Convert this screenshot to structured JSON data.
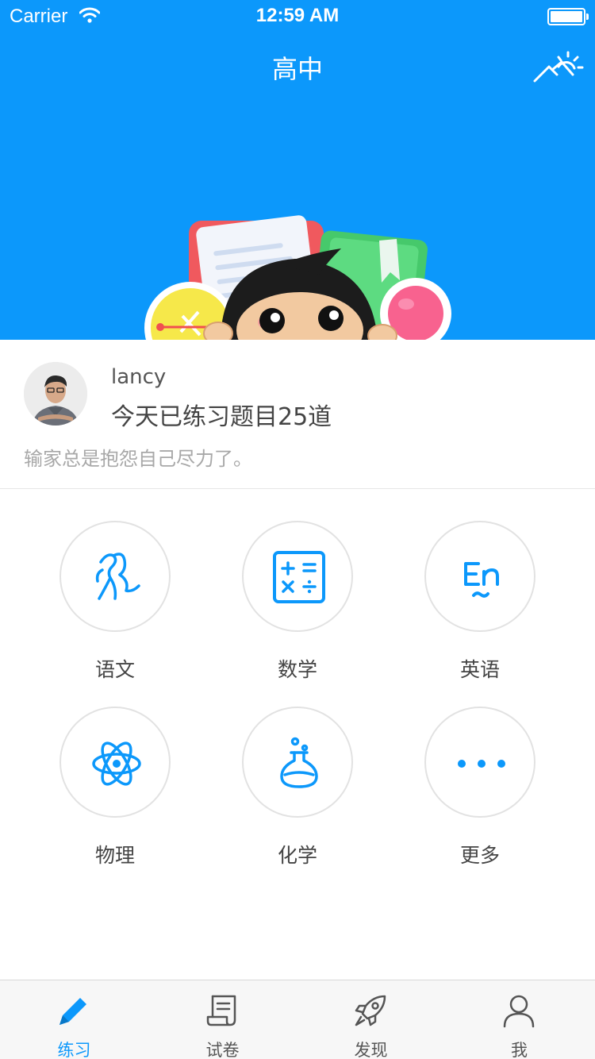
{
  "status_bar": {
    "carrier": "Carrier",
    "time": "12:59 AM"
  },
  "nav": {
    "title": "高中",
    "weather_icon": "weather-sun-mountain-icon"
  },
  "profile": {
    "username": "lancy",
    "today_text": "今天已练习题目25道",
    "motto": "输家总是抱怨自己尽力了。"
  },
  "subjects": [
    {
      "label": "语文",
      "icon": "chinese-brush-icon"
    },
    {
      "label": "数学",
      "icon": "calculator-icon"
    },
    {
      "label": "英语",
      "icon": "english-en-icon"
    },
    {
      "label": "物理",
      "icon": "atom-icon"
    },
    {
      "label": "化学",
      "icon": "flask-icon"
    },
    {
      "label": "更多",
      "icon": "more-dots-icon"
    }
  ],
  "tabs": [
    {
      "label": "练习",
      "icon": "pencil-icon",
      "active": true
    },
    {
      "label": "试卷",
      "icon": "scroll-icon",
      "active": false
    },
    {
      "label": "发现",
      "icon": "rocket-icon",
      "active": false
    },
    {
      "label": "我",
      "icon": "person-icon",
      "active": false
    }
  ],
  "colors": {
    "brand_blue": "#0c98fb",
    "active_tab": "#0c98fb",
    "text_gray": "#a8a8a8"
  }
}
